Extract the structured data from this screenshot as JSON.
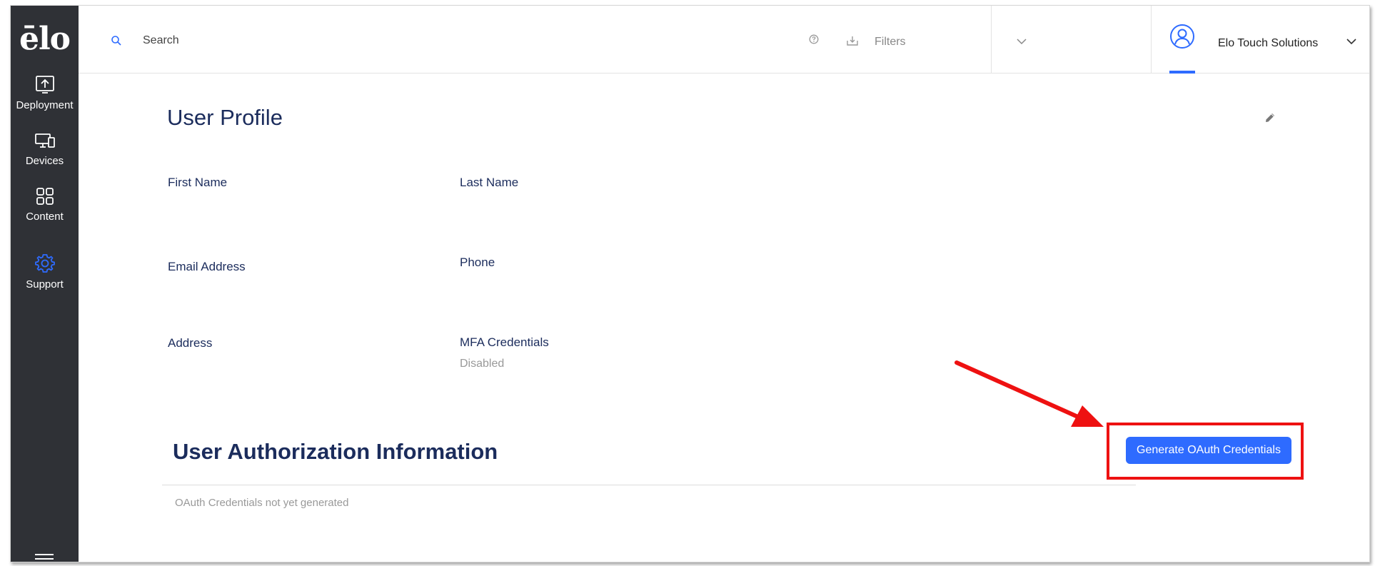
{
  "sidebar": {
    "logo": "ēlo",
    "items": [
      {
        "label": "Deployment",
        "icon": "deployment-upload-icon",
        "active": false
      },
      {
        "label": "Devices",
        "icon": "devices-icon",
        "active": false
      },
      {
        "label": "Content",
        "icon": "content-grid-icon",
        "active": false
      },
      {
        "label": "Support",
        "icon": "gear-icon",
        "active": true
      }
    ],
    "menu_icon": "hamburger-menu-icon"
  },
  "header": {
    "search": {
      "placeholder": "Search",
      "icon": "search-icon"
    },
    "help_icon": "help-circle-icon",
    "filters": {
      "label": "Filters",
      "icon": "download-icon",
      "chevron": "chevron-down-icon"
    },
    "account": {
      "name": "Elo Touch Solutions",
      "icon": "user-avatar-icon"
    }
  },
  "profile": {
    "title": "User Profile",
    "edit_icon": "pencil-icon",
    "fields": {
      "first_name": "First Name",
      "last_name": "Last Name",
      "email": "Email Address",
      "phone": "Phone",
      "address": "Address",
      "mfa": "MFA Credentials",
      "mfa_value": "Disabled"
    }
  },
  "authorization": {
    "title": "User Authorization Information",
    "button_label": "Generate OAuth Credentials",
    "empty_text": "OAuth Credentials not yet generated"
  },
  "colors": {
    "sidebar_bg": "#2f3136",
    "accent": "#2e6bff",
    "heading": "#1b2c5c",
    "annotation": "#ee1111"
  }
}
